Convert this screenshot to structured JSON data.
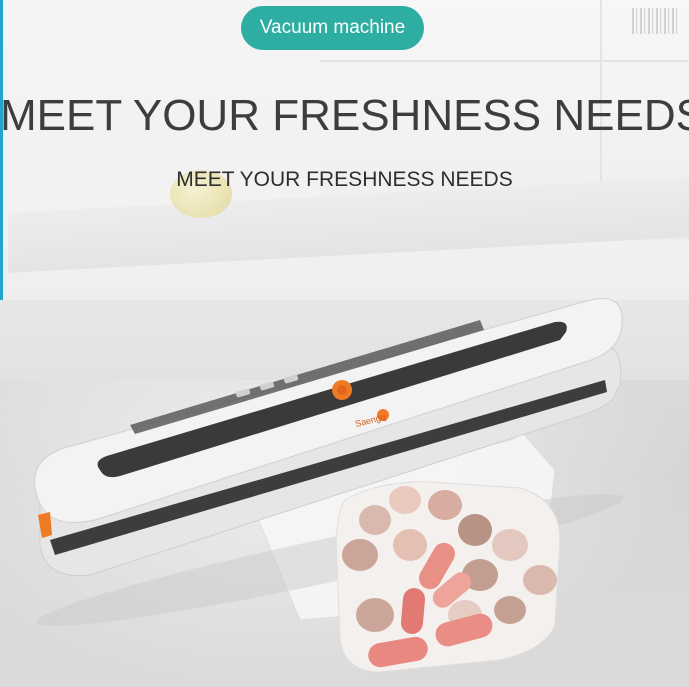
{
  "badge": {
    "label": "Vacuum machine"
  },
  "headline": "MEET YOUR FRESHNESS NEEDS",
  "subheadline": "MEET YOUR FRESHNESS NEEDS",
  "product": {
    "brand_logo_text": "Saengq"
  },
  "colors": {
    "accent": "#2eaea2",
    "frame_border": "#21a6c8",
    "machine_body": "#f2f2f2",
    "button_orange": "#f07a24"
  }
}
